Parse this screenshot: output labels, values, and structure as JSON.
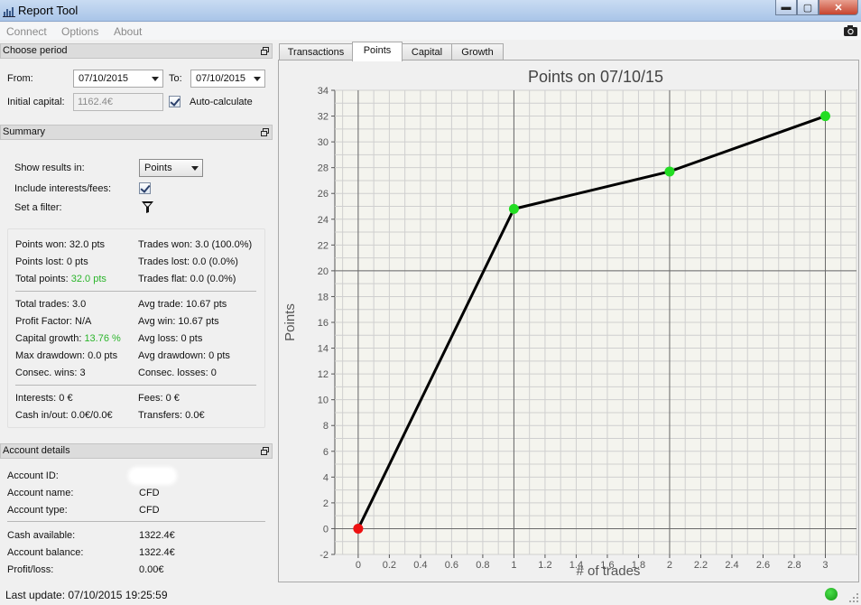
{
  "window": {
    "title": "Report Tool",
    "minimize": "▬",
    "maximize": "▢",
    "close": "✕"
  },
  "menu": [
    {
      "label": "Connect"
    },
    {
      "label": "Options"
    },
    {
      "label": "About"
    }
  ],
  "period": {
    "title": "Choose period",
    "from_label": "From:",
    "from_value": "07/10/2015",
    "to_label": "To:",
    "to_value": "07/10/2015",
    "capital_label": "Initial capital:",
    "capital_value": "1162.4€",
    "auto_calculate_label": "Auto-calculate",
    "auto_calculate_checked": true
  },
  "summary": {
    "title": "Summary",
    "show_results_label": "Show results in:",
    "show_results_value": "Points",
    "include_fees_label": "Include interests/fees:",
    "include_fees_checked": true,
    "filter_label": "Set a filter:",
    "stats": {
      "points_won": "Points won: 32.0 pts",
      "trades_won": "Trades won: 3.0 (100.0%)",
      "points_lost": "Points lost: 0 pts",
      "trades_lost": "Trades lost: 0.0 (0.0%)",
      "total_points_label": "Total points: ",
      "total_points_value": "32.0 pts",
      "trades_flat": "Trades flat: 0.0 (0.0%)",
      "total_trades": "Total trades: 3.0",
      "avg_trade": "Avg trade: 10.67 pts",
      "profit_factor": "Profit Factor: N/A",
      "avg_win": "Avg win: 10.67 pts",
      "capital_growth_label": "Capital growth: ",
      "capital_growth_value": "13.76 %",
      "avg_loss": "Avg loss: 0 pts",
      "max_drawdown": "Max drawdown: 0.0 pts",
      "avg_drawdown": "Avg drawdown: 0 pts",
      "consec_wins": "Consec. wins: 3",
      "consec_losses": "Consec. losses: 0",
      "interests": "Interests: 0 €",
      "fees": "Fees: 0 €",
      "cash_in_out": "Cash in/out: 0.0€/0.0€",
      "transfers": "Transfers: 0.0€"
    },
    "positive_color": "#2bb52b"
  },
  "account": {
    "title": "Account details",
    "id_label": "Account ID:",
    "name_label": "Account name:",
    "name_value": "CFD",
    "type_label": "Account type:",
    "type_value": "CFD",
    "cash_label": "Cash available:",
    "cash_value": "1322.4€",
    "balance_label": "Account balance:",
    "balance_value": "1322.4€",
    "pl_label": "Profit/loss:",
    "pl_value": "0.00€"
  },
  "tabs": [
    {
      "label": "Transactions",
      "active": false
    },
    {
      "label": "Points",
      "active": true
    },
    {
      "label": "Capital",
      "active": false
    },
    {
      "label": "Growth",
      "active": false
    }
  ],
  "status": {
    "last_update": "Last update: 07/10/2015 19:25:59",
    "connection_color": "#2bc42b"
  },
  "chart_data": {
    "type": "line",
    "title": "Points on 07/10/15",
    "xlabel": "# of trades",
    "ylabel": "Points",
    "x": [
      0,
      1,
      2,
      3
    ],
    "y": [
      0,
      24.8,
      27.7,
      32
    ],
    "point_colors": [
      "#ee1111",
      "#22dd22",
      "#22dd22",
      "#22dd22"
    ],
    "xlim": [
      -0.15,
      3.2
    ],
    "ylim": [
      -2,
      34
    ],
    "xticks": [
      0,
      0.2,
      0.4,
      0.6,
      0.8,
      1,
      1.2,
      1.4,
      1.6,
      1.8,
      2,
      2.2,
      2.4,
      2.6,
      2.8,
      3
    ],
    "xtick_labels": [
      "0",
      "0.2",
      "0.4",
      "0.6",
      "0.8",
      "1",
      "1.2",
      "1.4",
      "1.6",
      "1.8",
      "2",
      "2.2",
      "2.4",
      "2.6",
      "2.8",
      "3"
    ],
    "yticks": [
      -2,
      0,
      2,
      4,
      6,
      8,
      10,
      12,
      14,
      16,
      18,
      20,
      22,
      24,
      26,
      28,
      30,
      32,
      34
    ],
    "ytick_labels": [
      "-2",
      "0",
      "2",
      "4",
      "6",
      "8",
      "10",
      "12",
      "14",
      "16",
      "18",
      "20",
      "22",
      "24",
      "26",
      "28",
      "30",
      "32",
      "34"
    ],
    "major_x": [
      0,
      1,
      2,
      3
    ],
    "major_y": [
      0,
      20
    ],
    "grid": true,
    "line_color": "#000000"
  }
}
